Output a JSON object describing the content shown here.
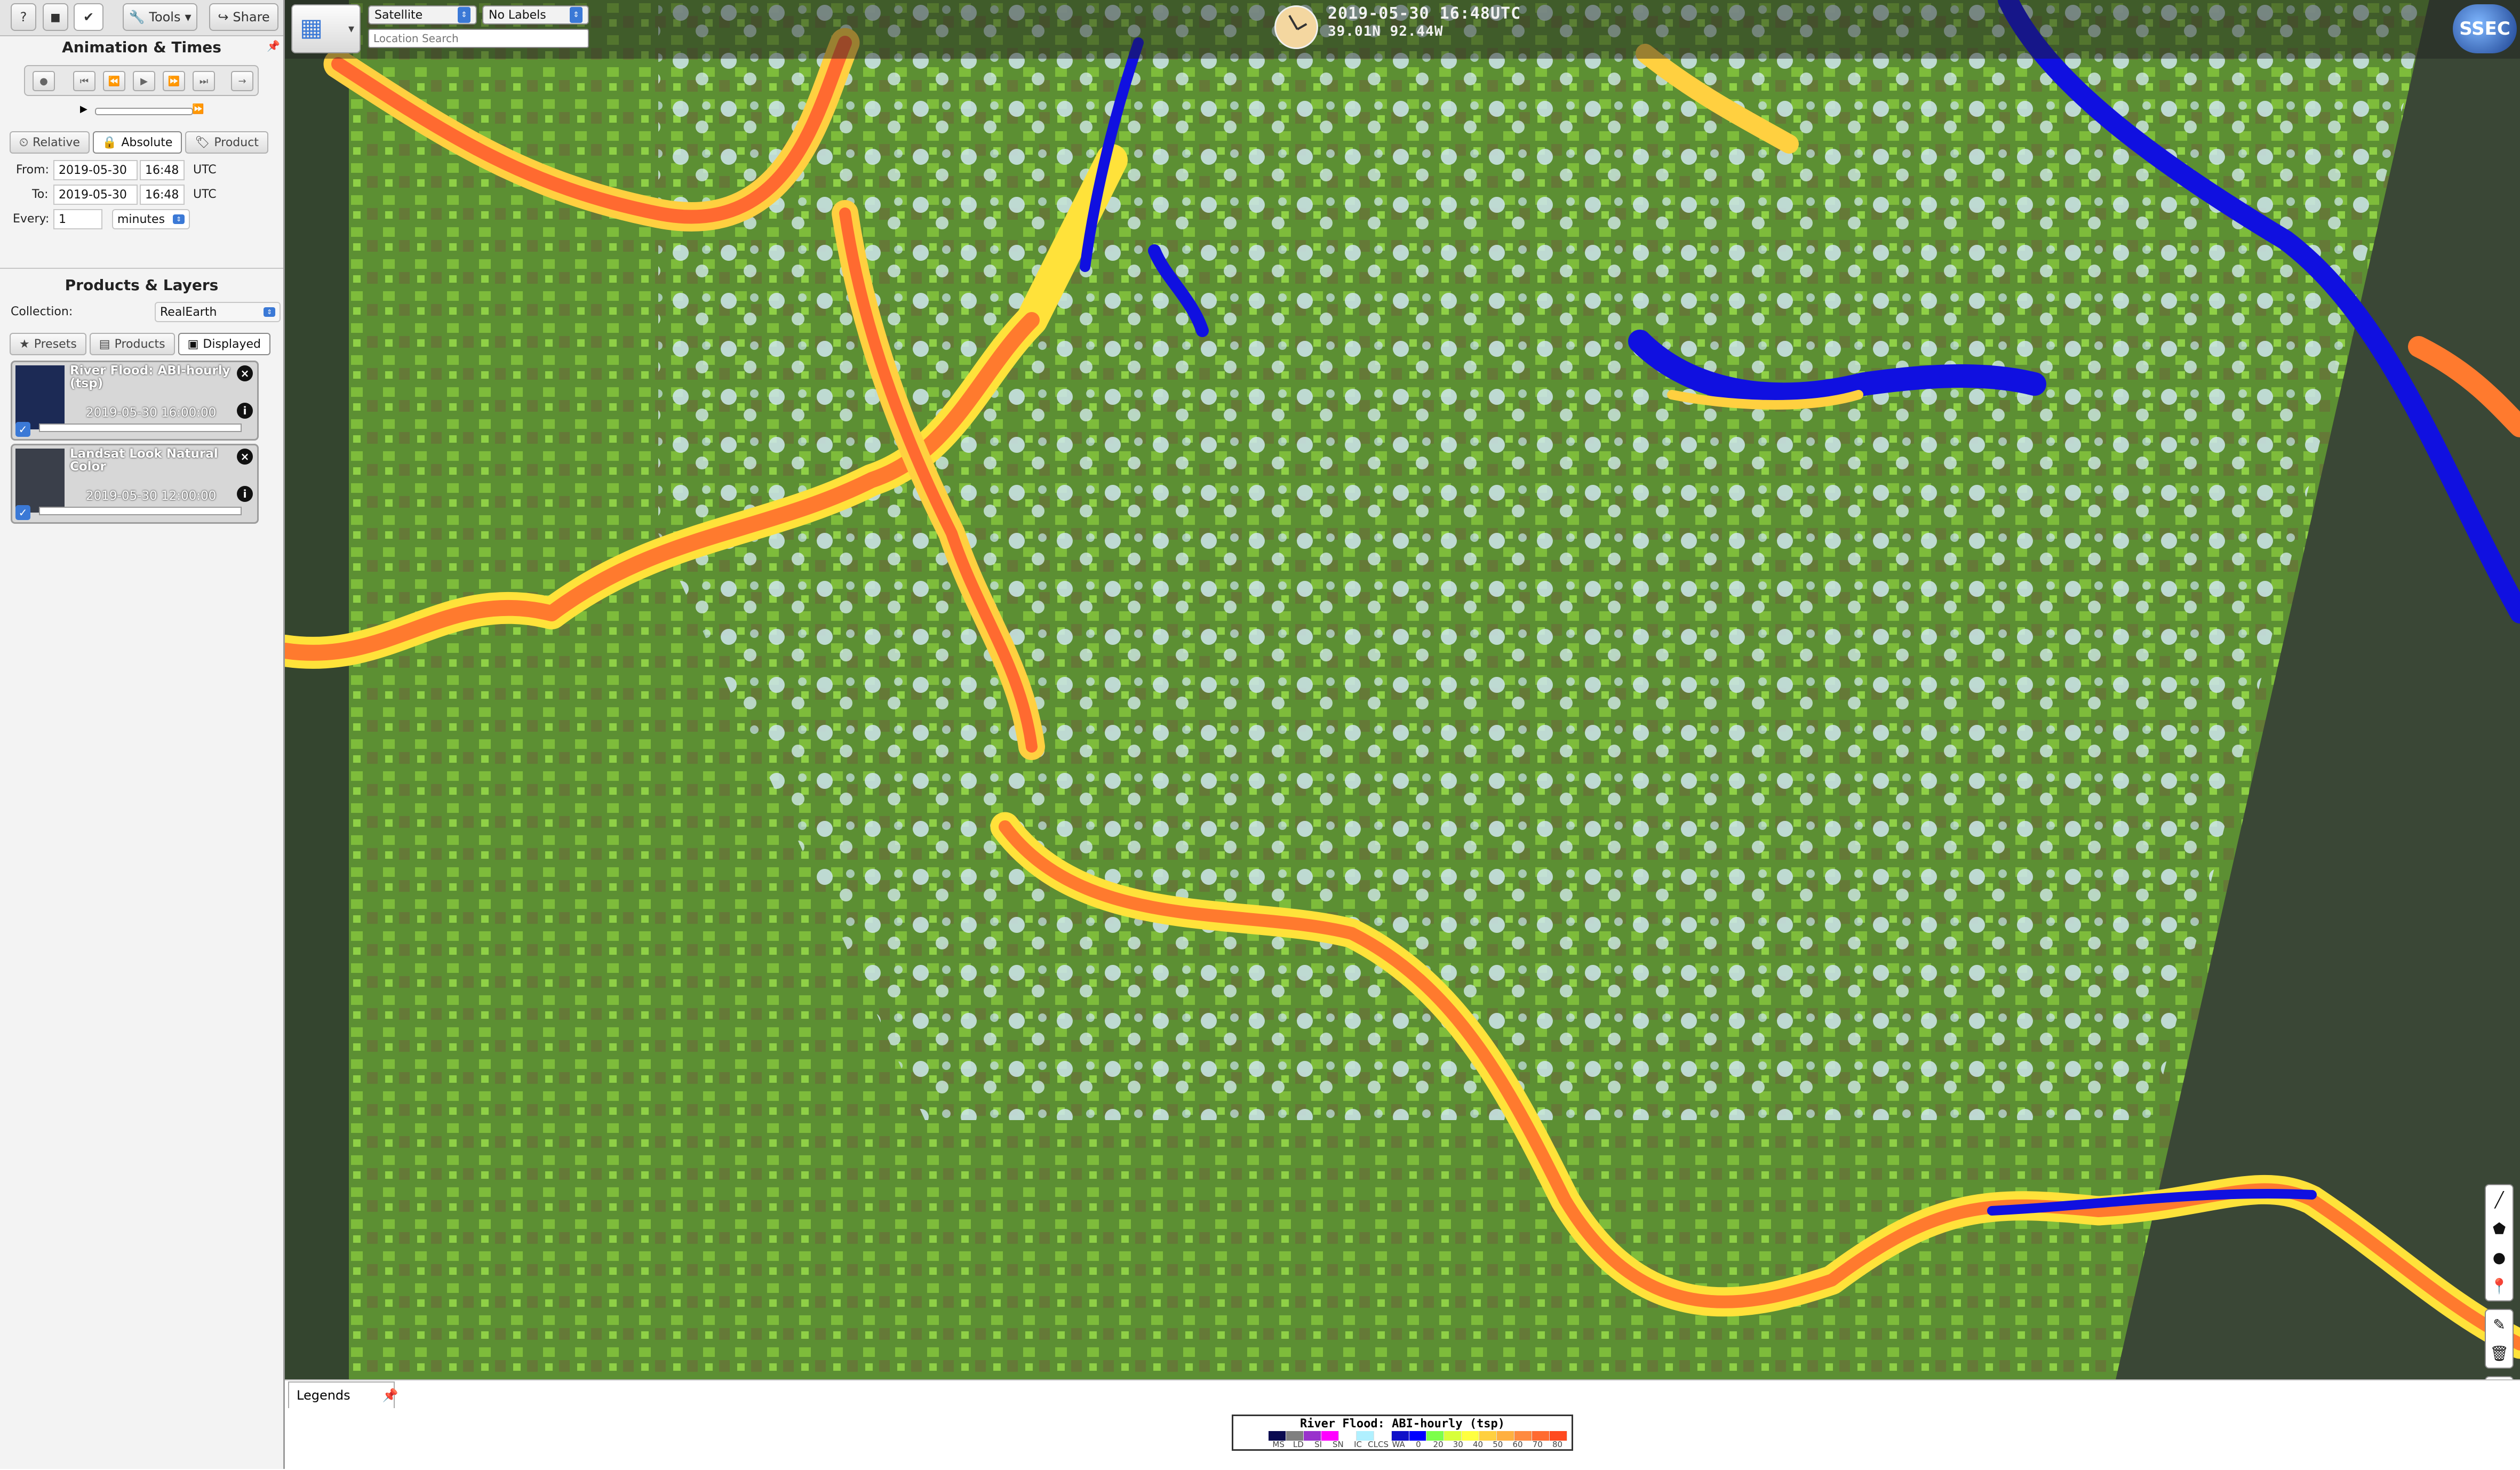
{
  "toolbar": {
    "help_label": "?",
    "stop_label": "◼",
    "check_label": "✔",
    "tools_label": "Tools",
    "share_label": "Share"
  },
  "animation": {
    "title": "Animation & Times",
    "tabs": [
      "Relative",
      "Absolute",
      "Product"
    ],
    "active_tab": "Absolute",
    "from_label": "From:",
    "from_date": "2019-05-30",
    "from_time": "16:48",
    "to_label": "To:",
    "to_date": "2019-05-30",
    "to_time": "16:48",
    "tz": "UTC",
    "every_label": "Every:",
    "every_value": "1",
    "every_unit": "minutes"
  },
  "products": {
    "title": "Products & Layers",
    "collection_label": "Collection:",
    "collection_value": "RealEarth",
    "tabs": [
      "Presets",
      "Products",
      "Displayed"
    ],
    "active_tab": "Displayed",
    "layers": [
      {
        "name": "River Flood: ABI-hourly (tsp)",
        "time": "2019-05-30 16:00:00"
      },
      {
        "name": "Landsat Look Natural Color",
        "time": "2019-05-30 12:00:00"
      }
    ]
  },
  "map": {
    "basemap_select": "Satellite",
    "labels_select": "No Labels",
    "location_placeholder": "Location Search",
    "datetime": "2019-05-30 16:48UTC",
    "coords": "39.01N 92.44W",
    "logo_text": "SSEC"
  },
  "legend": {
    "tab_label": "Legends",
    "title": "River Flood: ABI-hourly (tsp)",
    "labels": [
      "MS",
      "LD",
      "SI",
      "SN",
      "IC",
      "CLCS",
      "WA",
      "0",
      "20",
      "30",
      "40",
      "50",
      "60",
      "70",
      "80"
    ],
    "colors": [
      "#0a0a50",
      "#7f7f7f",
      "#9932cc",
      "#ff00ff",
      "#ffffff",
      "#b0f0ff",
      "#ffffff",
      "#1010c8",
      "#0000ff",
      "#7cff4a",
      "#d8ff3a",
      "#ffff40",
      "#ffd040",
      "#ffb040",
      "#ff8a40",
      "#ff6a30",
      "#ff4a20"
    ]
  }
}
